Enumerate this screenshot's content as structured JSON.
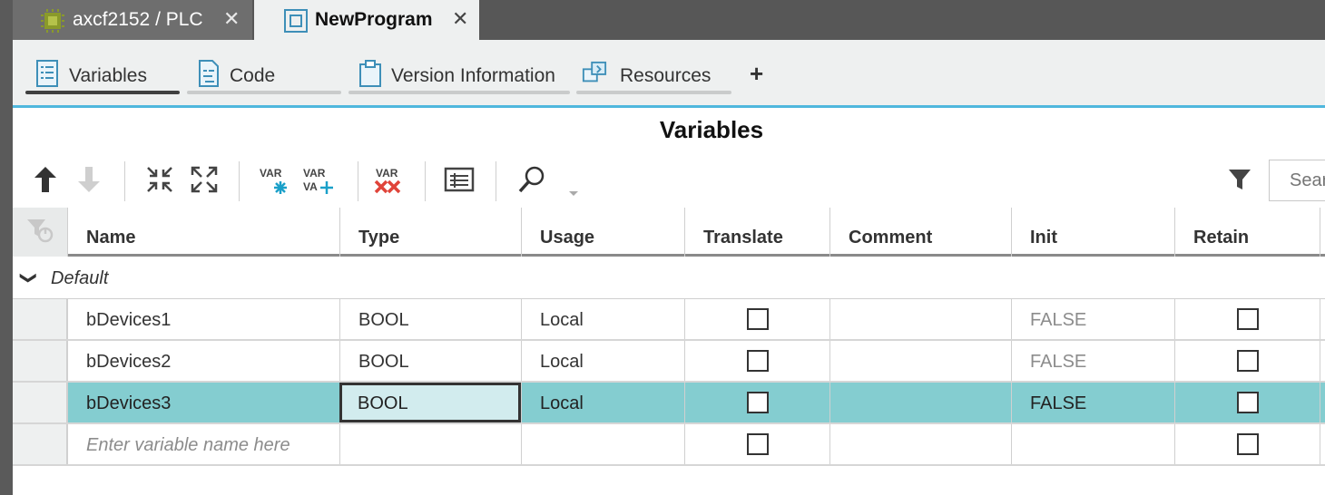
{
  "doc_tabs": [
    {
      "label": "axcf2152 / PLC",
      "close": "✕",
      "active": false
    },
    {
      "label": "NewProgram",
      "close": "✕",
      "active": true
    }
  ],
  "sub_tabs": [
    {
      "label": "Variables",
      "active": true
    },
    {
      "label": "Code",
      "active": false
    },
    {
      "label": "Version Information",
      "active": false
    },
    {
      "label": "Resources",
      "active": false
    }
  ],
  "add_tab_label": "+",
  "panel_title": "Variables",
  "toolbar": {
    "var_label": "VAR",
    "search_placeholder": "Search"
  },
  "columns": [
    "Name",
    "Type",
    "Usage",
    "Translate",
    "Comment",
    "Init",
    "Retain"
  ],
  "group": {
    "label": "Default",
    "chevron": "❯"
  },
  "rows": [
    {
      "name": "bDevices1",
      "type": "BOOL",
      "usage": "Local",
      "init": "FALSE",
      "translate": false,
      "retain": false
    },
    {
      "name": "bDevices2",
      "type": "BOOL",
      "usage": "Local",
      "init": "FALSE",
      "translate": false,
      "retain": false
    },
    {
      "name": "bDevices3",
      "type": "BOOL",
      "usage": "Local",
      "init": "FALSE",
      "translate": false,
      "retain": false,
      "selected": true
    }
  ],
  "new_row": {
    "placeholder": "Enter variable name here"
  },
  "colors": {
    "tab_bar": "#575757",
    "accent_line": "#4fb7dd",
    "selected_row": "#84cdd0",
    "delete_red": "#e0443a",
    "add_teal": "#1aa0c9"
  }
}
